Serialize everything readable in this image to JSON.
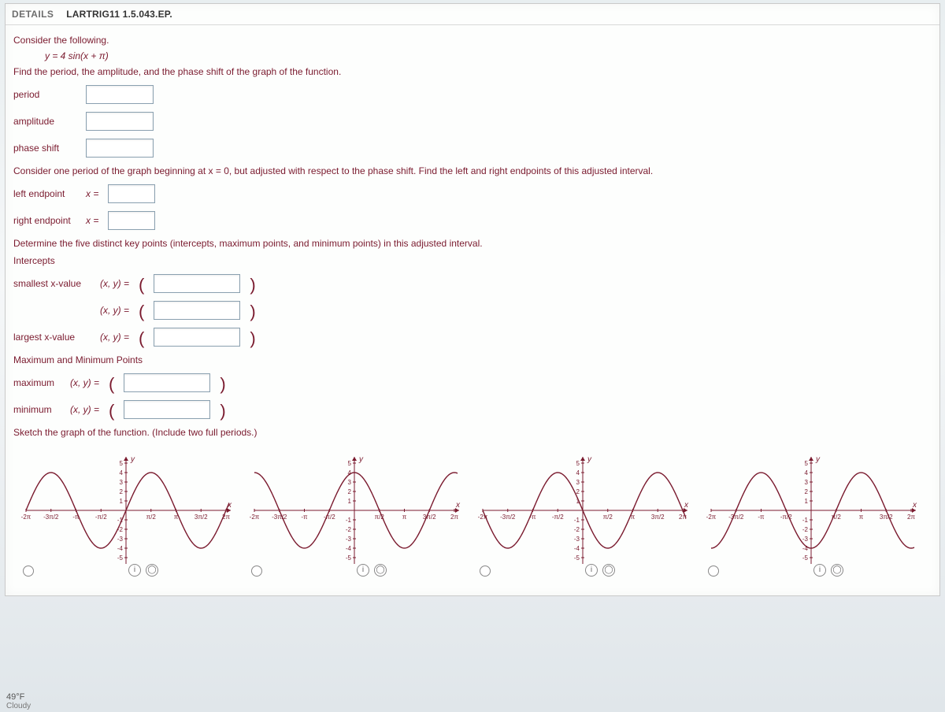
{
  "header": {
    "details_label": "DETAILS",
    "reference": "LARTRIG11 1.5.043.EP."
  },
  "intro": {
    "consider": "Consider the following.",
    "equation": "y = 4 sin(x + π)",
    "find": "Find the period, the amplitude, and the phase shift of the graph of the function."
  },
  "fields": {
    "period_label": "period",
    "amplitude_label": "amplitude",
    "phase_label": "phase shift",
    "period_value": "",
    "amplitude_value": "",
    "phase_value": ""
  },
  "endpoints": {
    "prompt": "Consider one period of the graph beginning at x = 0, but adjusted with respect to the phase shift. Find the left and right endpoints of this adjusted interval.",
    "left_label": "left endpoint",
    "right_label": "right endpoint",
    "x_eq": "x =",
    "left_value": "",
    "right_value": ""
  },
  "keypoints": {
    "prompt": "Determine the five distinct key points (intercepts, maximum points, and minimum points) in this adjusted interval.",
    "intercepts_label": "Intercepts",
    "smallest_label": "smallest x-value",
    "largest_label": "largest x-value",
    "xy_eq": "(x, y)  =",
    "smallest_value": "",
    "middle_value": "",
    "largest_value": "",
    "maxmin_label": "Maximum and Minimum Points",
    "max_label": "maximum",
    "min_label": "minimum",
    "max_value": "",
    "min_value": ""
  },
  "sketch": {
    "prompt": "Sketch the graph of the function. (Include two full periods.)"
  },
  "chart_data": [
    {
      "type": "line",
      "title": "",
      "xlabel": "x",
      "ylabel": "y",
      "xlim": [
        -6.283,
        6.283
      ],
      "ylim": [
        -5,
        5
      ],
      "x_ticks": [
        "-2π",
        "-3π/2",
        "-π",
        "-π/2",
        "π/2",
        "π",
        "3π/2",
        "2π"
      ],
      "y_ticks": [
        -5,
        -4,
        -3,
        -2,
        -1,
        1,
        2,
        3,
        4,
        5
      ],
      "series": [
        {
          "name": "y=4sin(x)",
          "shape": "sine",
          "amplitude": 4,
          "period": 6.283,
          "phase": 0
        }
      ]
    },
    {
      "type": "line",
      "xlabel": "x",
      "ylabel": "y",
      "xlim": [
        -6.283,
        6.283
      ],
      "ylim": [
        -5,
        5
      ],
      "x_ticks": [
        "-2π",
        "-3π/2",
        "-π",
        "-π/2",
        "π/2",
        "π",
        "3π/2",
        "2π"
      ],
      "y_ticks": [
        -5,
        -4,
        -3,
        -2,
        -1,
        1,
        2,
        3,
        4,
        5
      ],
      "series": [
        {
          "name": "y=4cos(x)",
          "shape": "cosine",
          "amplitude": 4,
          "period": 6.283,
          "phase": 0
        }
      ]
    },
    {
      "type": "line",
      "xlabel": "x",
      "ylabel": "y",
      "xlim": [
        -6.283,
        6.283
      ],
      "ylim": [
        -5,
        5
      ],
      "x_ticks": [
        "-2π",
        "-3π/2",
        "-π",
        "-π/2",
        "π/2",
        "π",
        "3π/2",
        "2π"
      ],
      "y_ticks": [
        -5,
        -4,
        -3,
        -2,
        -1,
        1,
        2,
        3,
        4,
        5
      ],
      "series": [
        {
          "name": "y=-4sin(x)",
          "shape": "sine",
          "amplitude": -4,
          "period": 6.283,
          "phase": 0
        }
      ]
    },
    {
      "type": "line",
      "xlabel": "x",
      "ylabel": "y",
      "xlim": [
        -6.283,
        6.283
      ],
      "ylim": [
        -5,
        5
      ],
      "x_ticks": [
        "-2π",
        "-3π/2",
        "-π",
        "-π/2",
        "π/2",
        "π",
        "3π/2",
        "2π"
      ],
      "y_ticks": [
        -5,
        -4,
        -3,
        -2,
        -1,
        1,
        2,
        3,
        4,
        5
      ],
      "series": [
        {
          "name": "y=-4cos(x)",
          "shape": "cosine",
          "amplitude": -4,
          "period": 6.283,
          "phase": 0
        }
      ]
    }
  ],
  "footer": {
    "temp": "49°F",
    "cond": "Cloudy"
  }
}
